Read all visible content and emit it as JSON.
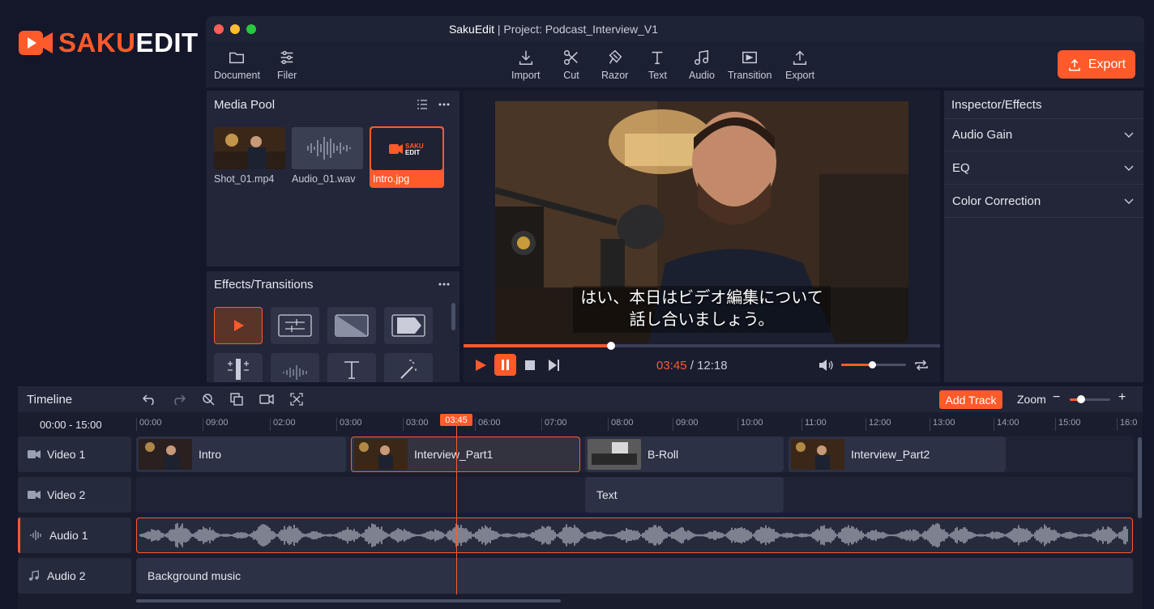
{
  "brand": {
    "name_accent": "SAKU",
    "name_rest": "EDIT",
    "accent": "#ff5a2a"
  },
  "window": {
    "app": "SakuEdit",
    "separator": " | ",
    "project": "Project: Podcast_Interview_V1"
  },
  "toolbar": {
    "left": [
      {
        "label": "Document",
        "icon": "folder-icon"
      },
      {
        "label": "Filer",
        "icon": "sliders-icon"
      }
    ],
    "center": [
      {
        "label": "Import",
        "icon": "download-icon"
      },
      {
        "label": "Cut",
        "icon": "scissors-icon"
      },
      {
        "label": "Razor",
        "icon": "razor-icon"
      },
      {
        "label": "Text",
        "icon": "text-icon"
      },
      {
        "label": "Audio",
        "icon": "music-note-icon"
      },
      {
        "label": "Transition",
        "icon": "transition-icon"
      },
      {
        "label": "Export",
        "icon": "upload-icon"
      }
    ],
    "export_button": "Export"
  },
  "media_pool": {
    "title": "Media Pool",
    "items": [
      {
        "label": "Shot_01.mp4",
        "selected": false
      },
      {
        "label": "Audio_01.wav",
        "selected": false
      },
      {
        "label": "Intro.jpg",
        "selected": true,
        "thumb_text": "SAKU EDIT"
      }
    ]
  },
  "effects": {
    "title": "Effects/Transitions"
  },
  "inspector": {
    "title": "Inspector/Effects",
    "sections": [
      "Audio Gain",
      "EQ",
      "Color Correction"
    ]
  },
  "preview": {
    "subtitle_line1": "はい、本日はビデオ編集について",
    "subtitle_line2": "話し合いましょう。",
    "current_time": "03:45",
    "separator": " / ",
    "total_time": "12:18",
    "progress": 0.31,
    "volume": 0.47
  },
  "timeline": {
    "title": "Timeline",
    "add_track": "Add Track",
    "zoom_label": "Zoom",
    "zoom_minus": "−",
    "zoom_plus": "+",
    "range": "00:00 - 15:00",
    "playhead": "03:45",
    "ruler": [
      "00:00",
      "09:00",
      "02:00",
      "03:00",
      "03:00",
      "06:00",
      "07:00",
      "08:00",
      "09:00",
      "10:00",
      "11:00",
      "12:00",
      "13:00",
      "14:00",
      "15:00",
      "16:0"
    ],
    "tracks": [
      {
        "name": "Video 1",
        "icon": "video-camera-icon"
      },
      {
        "name": "Video 2",
        "icon": "video-camera-icon"
      },
      {
        "name": "Audio 1",
        "icon": "waveform-icon"
      },
      {
        "name": "Audio 2",
        "icon": "music-note-icon"
      }
    ],
    "clips": {
      "intro": "Intro",
      "interview1": "Interview_Part1",
      "broll": "B-Roll",
      "interview2": "Interview_Part2",
      "text": "Text",
      "bgm": "Background music"
    }
  }
}
